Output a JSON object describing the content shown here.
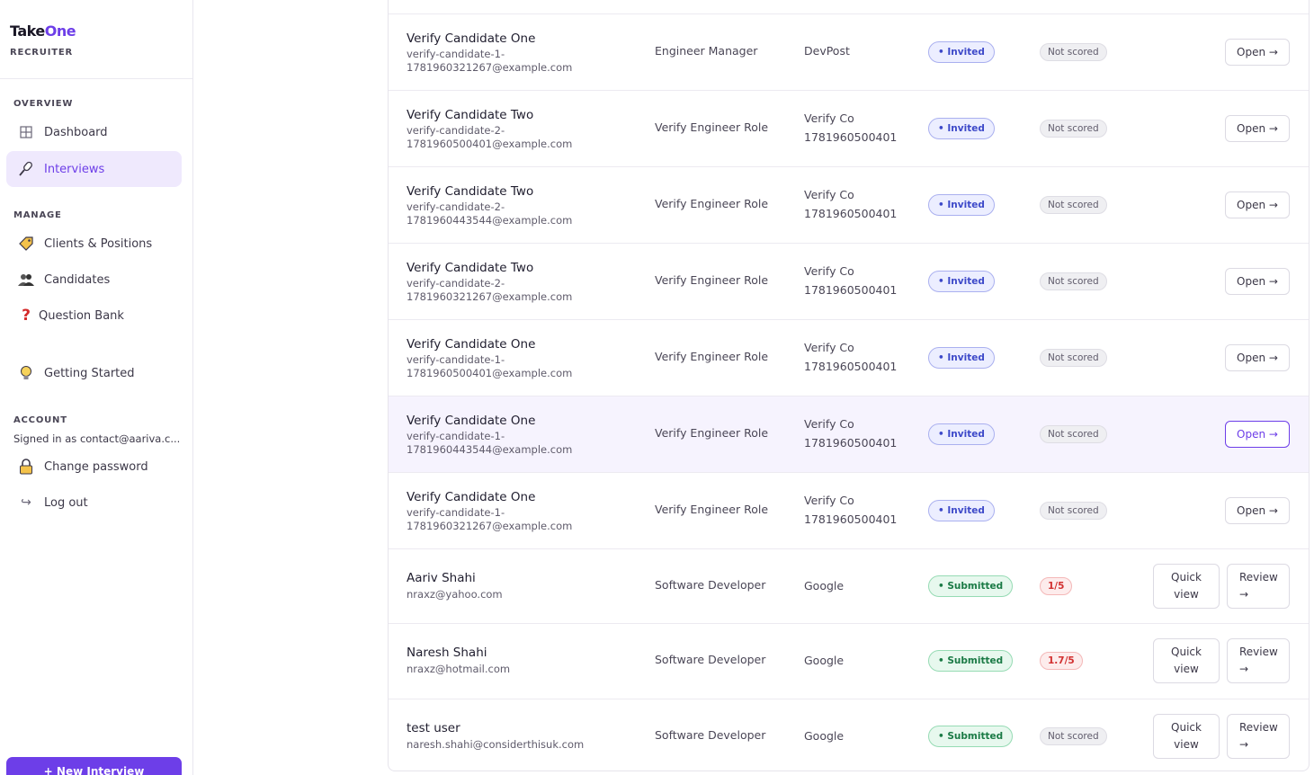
{
  "brand": {
    "part1": "Take",
    "part2": "One",
    "subtitle": "RECRUITER"
  },
  "sidebar": {
    "overview_label": "OVERVIEW",
    "manage_label": "MANAGE",
    "account_label": "ACCOUNT",
    "items": {
      "dashboard": "Dashboard",
      "interviews": "Interviews",
      "clients": "Clients & Positions",
      "candidates": "Candidates",
      "question_bank": "Question Bank",
      "getting_started": "Getting Started",
      "change_password": "Change password",
      "logout": "Log out"
    },
    "signed_in": "Signed in as contact@aariva.c...",
    "new_interview": "+ New Interview"
  },
  "colors": {
    "accent": "#6d3ee8",
    "invited": "#3d49c9",
    "submitted": "#1a7a45",
    "low_score": "#d23030"
  },
  "rows": [
    {
      "name": "Verify Candidate One",
      "email_1": "verify-candidate-1-",
      "email_2": "1781960321267@example.com",
      "role": "Engineer Manager",
      "company_1": "DevPost",
      "company_2": "",
      "status": "Invited",
      "score": "Not scored",
      "action": "Open →"
    },
    {
      "name": "Verify Candidate Two",
      "email_1": "verify-candidate-2-",
      "email_2": "1781960500401@example.com",
      "role": "Verify Engineer Role",
      "company_1": "Verify Co",
      "company_2": "1781960500401",
      "status": "Invited",
      "score": "Not scored",
      "action": "Open →"
    },
    {
      "name": "Verify Candidate Two",
      "email_1": "verify-candidate-2-",
      "email_2": "1781960443544@example.com",
      "role": "Verify Engineer Role",
      "company_1": "Verify Co",
      "company_2": "1781960500401",
      "status": "Invited",
      "score": "Not scored",
      "action": "Open →"
    },
    {
      "name": "Verify Candidate Two",
      "email_1": "verify-candidate-2-",
      "email_2": "1781960321267@example.com",
      "role": "Verify Engineer Role",
      "company_1": "Verify Co",
      "company_2": "1781960500401",
      "status": "Invited",
      "score": "Not scored",
      "action": "Open →"
    },
    {
      "name": "Verify Candidate One",
      "email_1": "verify-candidate-1-",
      "email_2": "1781960500401@example.com",
      "role": "Verify Engineer Role",
      "company_1": "Verify Co",
      "company_2": "1781960500401",
      "status": "Invited",
      "score": "Not scored",
      "action": "Open →"
    },
    {
      "name": "Verify Candidate One",
      "email_1": "verify-candidate-1-",
      "email_2": "1781960443544@example.com",
      "role": "Verify Engineer Role",
      "company_1": "Verify Co",
      "company_2": "1781960500401",
      "status": "Invited",
      "score": "Not scored",
      "action": "Open →"
    },
    {
      "name": "Verify Candidate One",
      "email_1": "verify-candidate-1-",
      "email_2": "1781960321267@example.com",
      "role": "Verify Engineer Role",
      "company_1": "Verify Co",
      "company_2": "1781960500401",
      "status": "Invited",
      "score": "Not scored",
      "action": "Open →"
    },
    {
      "name": "Aariv Shahi",
      "email_1": "nraxz@yahoo.com",
      "email_2": "",
      "role": "Software Developer",
      "company_1": "Google",
      "company_2": "",
      "status": "Submitted",
      "score": "1/5",
      "quick_1": "Quick",
      "quick_2": "view",
      "review_1": "Review",
      "review_2": "→"
    },
    {
      "name": "Naresh Shahi",
      "email_1": "nraxz@hotmail.com",
      "email_2": "",
      "role": "Software Developer",
      "company_1": "Google",
      "company_2": "",
      "status": "Submitted",
      "score": "1.7/5",
      "quick_1": "Quick",
      "quick_2": "view",
      "review_1": "Review",
      "review_2": "→"
    },
    {
      "name": "test user",
      "email_1": "naresh.shahi@considerthisuk.com",
      "email_2": "",
      "role": "Software Developer",
      "company_1": "Google",
      "company_2": "",
      "status": "Submitted",
      "score": "Not scored",
      "quick_1": "Quick",
      "quick_2": "view",
      "review_1": "Review",
      "review_2": "→"
    }
  ]
}
